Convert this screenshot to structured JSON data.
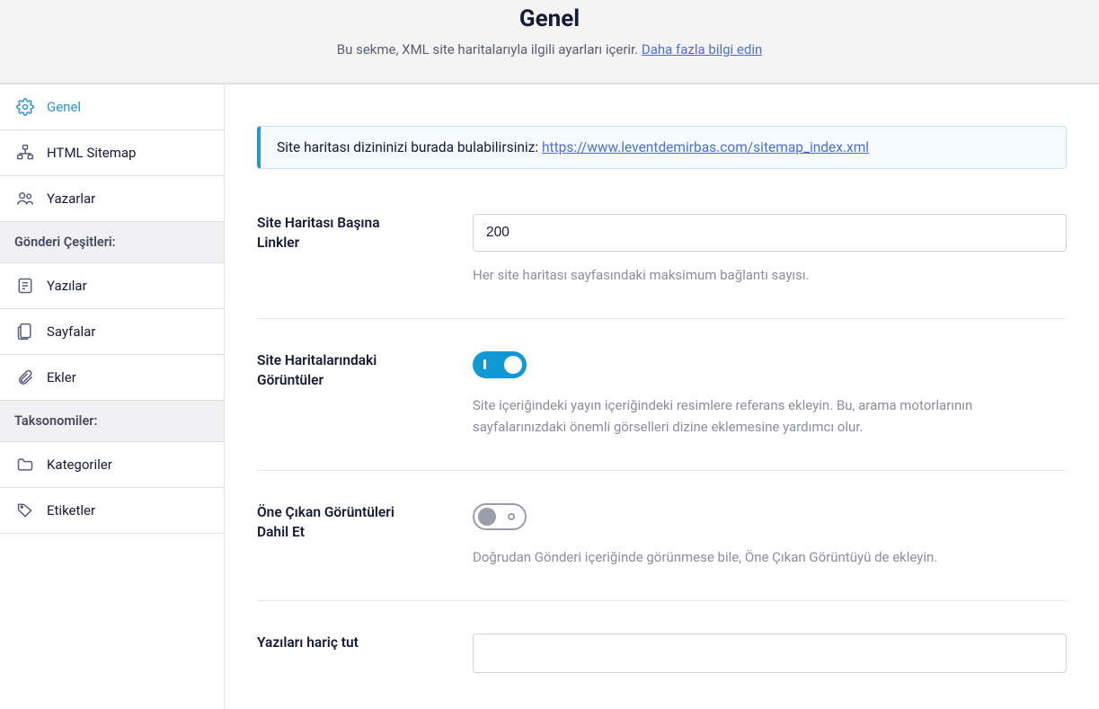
{
  "header": {
    "title": "Genel",
    "subtitle_prefix": "Bu sekme, XML site haritalarıyla ilgili ayarları içerir. ",
    "learn_more": "Daha fazla bilgi edin"
  },
  "sidebar": {
    "items": [
      {
        "label": "Genel",
        "icon": "gear-icon",
        "active": true
      },
      {
        "label": "HTML Sitemap",
        "icon": "sitemap-icon",
        "active": false
      },
      {
        "label": "Yazarlar",
        "icon": "authors-icon",
        "active": false
      }
    ],
    "post_types_header": "Gönderi Çeşitleri:",
    "post_types": [
      {
        "label": "Yazılar",
        "icon": "posts-icon"
      },
      {
        "label": "Sayfalar",
        "icon": "pages-icon"
      },
      {
        "label": "Ekler",
        "icon": "attachment-icon"
      }
    ],
    "taxonomies_header": "Taksonomiler:",
    "taxonomies": [
      {
        "label": "Kategoriler",
        "icon": "folder-icon"
      },
      {
        "label": "Etiketler",
        "icon": "tag-icon"
      }
    ]
  },
  "notice": {
    "text": "Site haritası dizininizi burada bulabilirsiniz: ",
    "url_label": "https://www.leventdemirbas.com/sitemap_index.xml"
  },
  "settings": {
    "links_per": {
      "label": "Site Haritası Başına Linkler",
      "value": "200",
      "desc": "Her site haritası sayfasındaki maksimum bağlantı sayısı."
    },
    "images": {
      "label": "Site Haritalarındaki Görüntüler",
      "desc": "Site içeriğindeki yayın içeriğindeki resimlere referans ekleyin. Bu, arama motorlarının sayfalarınızdaki önemli görselleri dizine eklemesine yardımcı olur."
    },
    "featured": {
      "label": "Öne Çıkan Görüntüleri Dahil Et",
      "desc": "Doğrudan Gönderi içeriğinde görünmese bile, Öne Çıkan Görüntüyü de ekleyin."
    },
    "exclude": {
      "label": "Yazıları hariç tut"
    }
  }
}
